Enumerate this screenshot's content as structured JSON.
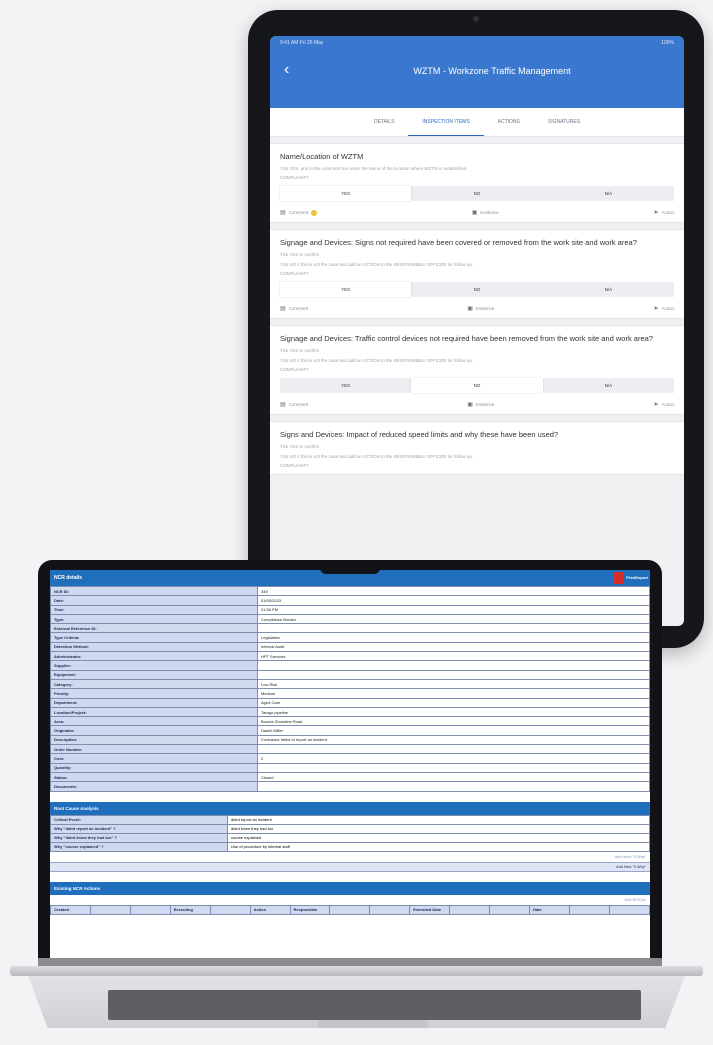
{
  "tablet": {
    "status_time": "9:41 AM  Fri 26 May",
    "status_right": "100%",
    "back_icon": "chevron-left-icon",
    "title": "WZTM - Workzone Traffic Management",
    "tabs": [
      {
        "label": "DETAILS"
      },
      {
        "label": "INSPECTION ITEMS"
      },
      {
        "label": "ACTIONS"
      },
      {
        "label": "SIGNATURES"
      }
    ],
    "active_tab": 1,
    "option_labels": {
      "yes": "YES",
      "no": "NO",
      "na": "N/A"
    },
    "footer": {
      "comment": "Comment",
      "evidence": "Evidence",
      "action": "Action"
    },
    "items": [
      {
        "question": "Name/Location of WZTM",
        "hint": "Tick YES, and in the comment box enter the name of the location where WZTM is established",
        "hint2": "",
        "compliant": "COMPLIANT?",
        "selected": "yes",
        "has_comment_badge": true
      },
      {
        "question": "Signage and Devices: Signs not required have been covered or removed from the work site and work area?",
        "hint": "Tick YES to confirm",
        "hint2": "Tick NO if this is not the case and add an ACTION to the RESPONSIBLE OFFICER for follow up.",
        "compliant": "COMPLIANT?",
        "selected": "yes",
        "has_comment_badge": false
      },
      {
        "question": "Signage and Devices: Traffic control devices not required have been removed from the work site and work area?",
        "hint": "Tick YES to confirm",
        "hint2": "Tick NO if this is not the case and add an ACTION to the RESPONSIBLE OFFICER for follow up.",
        "compliant": "COMPLIANT?",
        "selected": "no",
        "has_comment_badge": false
      },
      {
        "question": "Signs and Devices: Impact of reduced speed limits and why these have been used?",
        "hint": "Tick YES to confirm",
        "hint2": "Tick NO if this is not the case and add an ACTION to the RESPONSIBLE OFFICER for follow up.",
        "compliant": "COMPLIANT?",
        "selected": "none",
        "has_comment_badge": false
      }
    ]
  },
  "ncr": {
    "header": "NCR details",
    "export_label": "PrintExport",
    "fields": [
      {
        "label": "NCR ID:",
        "value": "349"
      },
      {
        "label": "Date:",
        "value": "01/05/2023"
      },
      {
        "label": "Time:",
        "value": "01:56 PM"
      },
      {
        "label": "Type:",
        "value": "Compliance Breach"
      },
      {
        "label": "External Reference ID:",
        "value": ""
      },
      {
        "label": "Type Criteria:",
        "value": "Legislative"
      },
      {
        "label": "Detection Method:",
        "value": "Internal Audit"
      },
      {
        "label": "Administrator:",
        "value": "HPT Services"
      },
      {
        "label": "Supplier:",
        "value": ""
      },
      {
        "label": "Equipment:",
        "value": ""
      },
      {
        "label": "Category:",
        "value": "Low Risk"
      },
      {
        "label": "Priority:",
        "value": "Medium"
      },
      {
        "label": "Department:",
        "value": "Aged Care"
      },
      {
        "label": "Location/Project:",
        "value": "Tarago pipeline"
      },
      {
        "label": "Area:",
        "value": "Bourke Shoreline Road"
      },
      {
        "label": "Originator:",
        "value": "Daniel Miller"
      },
      {
        "label": "Description:",
        "value": "Contractor failed to report an incident"
      },
      {
        "label": "Order Number:",
        "value": ""
      },
      {
        "label": "Cost:",
        "value": "0"
      },
      {
        "label": "Quantity:",
        "value": ""
      },
      {
        "label": "Status:",
        "value": "Closed"
      },
      {
        "label": "Documents:",
        "value": ""
      }
    ],
    "root_cause": {
      "header": "Root Cause Analysis",
      "rows": [
        {
          "label": "Critical Event:",
          "value": "didnt report an incident"
        },
        {
          "label": "Why \"didnt report an incident\" ?",
          "value": "didnt know they had too"
        },
        {
          "label": "Why \"didnt know they had too\" ?",
          "value": "course explained"
        },
        {
          "label": "Why \"course explained\" ?",
          "value": "Use of procedure by internal staff"
        }
      ],
      "add_link": "Add Issue \"5 Why\"",
      "add_button": "Add New \"5 Why\""
    },
    "actions": {
      "header": "Existing NCR Actions",
      "add_link": "Add NCR Ac",
      "columns": [
        "Created",
        "",
        "",
        "Executing",
        "",
        "Action",
        "Responsible",
        "",
        "",
        "Extended Date",
        "",
        "",
        "Date",
        "",
        ""
      ]
    }
  }
}
